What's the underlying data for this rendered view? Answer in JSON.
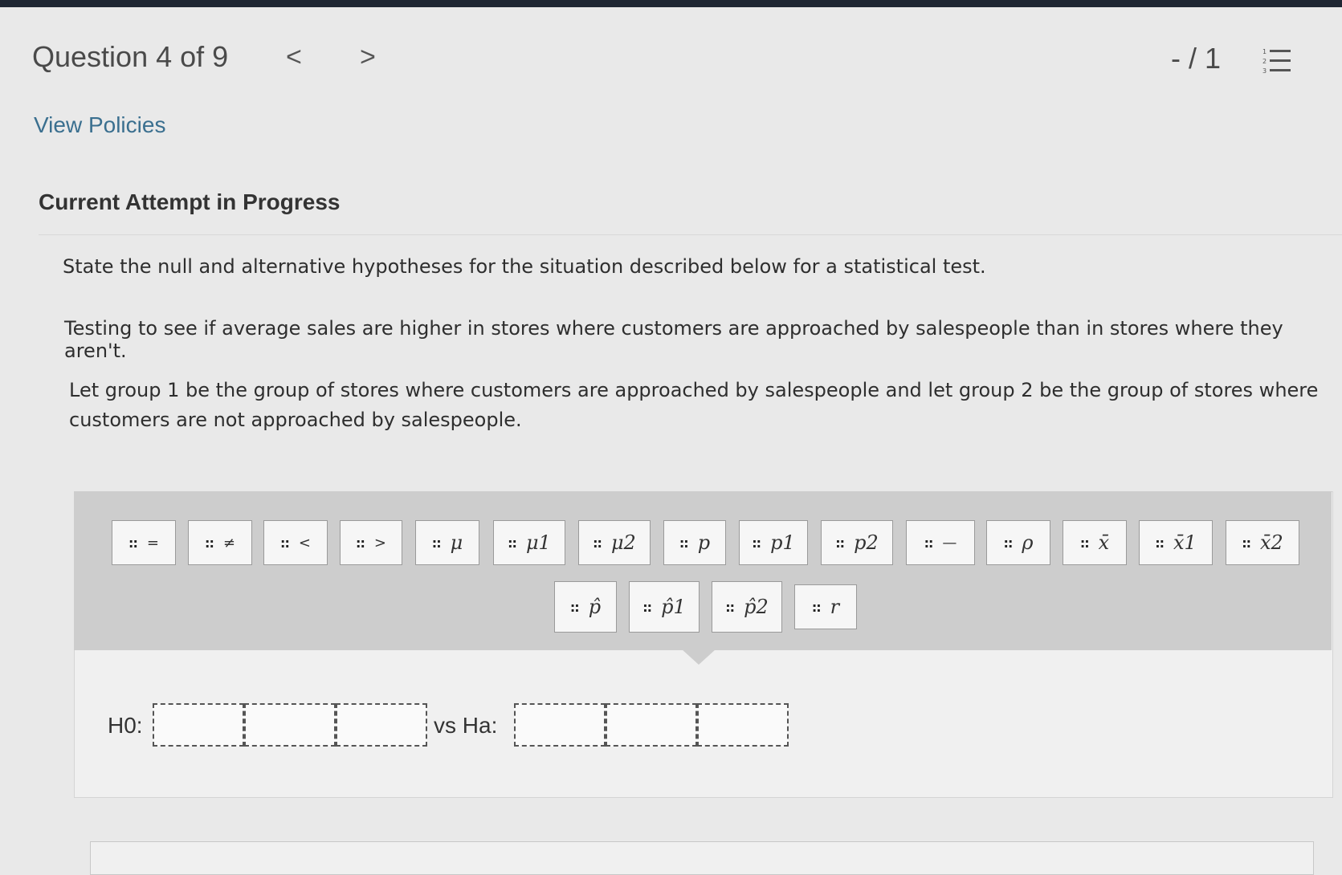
{
  "header": {
    "title": "Question 4 of 9",
    "prev": "<",
    "next": ">",
    "score": "- / 1"
  },
  "links": {
    "view_policies": "View Policies"
  },
  "attempt_status": "Current Attempt in Progress",
  "question": {
    "instruction": "State the null and alternative hypotheses for the situation described below for a statistical test.",
    "scenario": "Testing to see if average sales are higher in stores where customers are approached by salespeople than in stores where they aren't.",
    "groups": "Let group 1 be the group of stores where customers are approached by salespeople and let group 2 be the group of stores where customers are not approached by salespeople."
  },
  "palette": {
    "grip": "::",
    "tiles": [
      "=",
      "≠",
      "<",
      ">",
      "μ",
      "μ1",
      "μ2",
      "p",
      "p1",
      "p2",
      "—",
      "ρ",
      "x̄",
      "x̄1",
      "x̄2",
      "p̂",
      "p̂1",
      "p̂2",
      "r"
    ]
  },
  "answer": {
    "h0_label": "H0:",
    "ha_label": "vs Ha:"
  }
}
